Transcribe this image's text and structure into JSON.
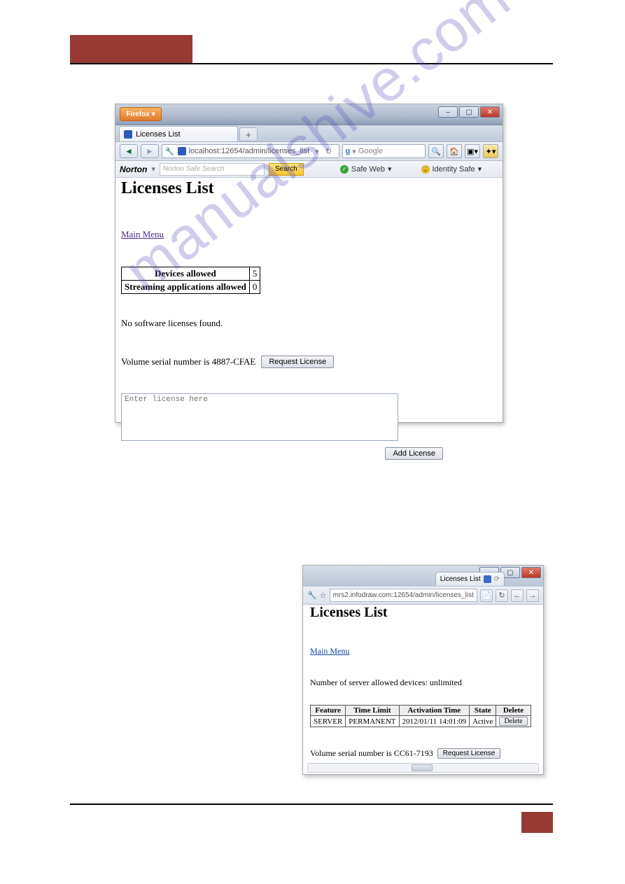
{
  "header": {},
  "screenshot1": {
    "firefox_label": "Firefox",
    "tab_title": "Licenses List",
    "new_tab_glyph": "+",
    "url": "localhost:12654/admin/licenses_list",
    "search_placeholder": "Google",
    "norton": {
      "brand": "Norton",
      "search_placeholder": "Norton Safe Search",
      "search_btn": "Search",
      "safe_web": "Safe Web",
      "identity_safe": "Identity Safe"
    },
    "page": {
      "title": "Licenses List",
      "main_menu": "Main Menu",
      "rows": [
        {
          "label": "Devices allowed",
          "value": "5"
        },
        {
          "label": "Streaming applications allowed",
          "value": "0"
        }
      ],
      "no_licenses": "No software licenses found.",
      "vsn_text": "Volume serial number is 4887-CFAE",
      "request_btn": "Request License",
      "textarea_placeholder": "Enter license here",
      "add_btn": "Add License"
    }
  },
  "deleting_heading": "",
  "screenshot2": {
    "tab_title": "Licenses List",
    "url": "mrs2.infodraw.com:12654/admin/licenses_list",
    "page": {
      "title": "Licenses List",
      "main_menu": "Main Menu",
      "allowed_text": "Number of server allowed devices: unlimited",
      "headers": [
        "Feature",
        "Time Limit",
        "Activation Time",
        "State",
        "Delete"
      ],
      "row": {
        "feature": "SERVER",
        "time_limit": "PERMANENT",
        "activation": "2012/01/11 14:01:09",
        "state": "Active",
        "delete_btn": "Delete"
      },
      "vsn_text": "Volume serial number is CC61-7193",
      "request_btn": "Request License"
    }
  },
  "watermark": "manualshive.com"
}
